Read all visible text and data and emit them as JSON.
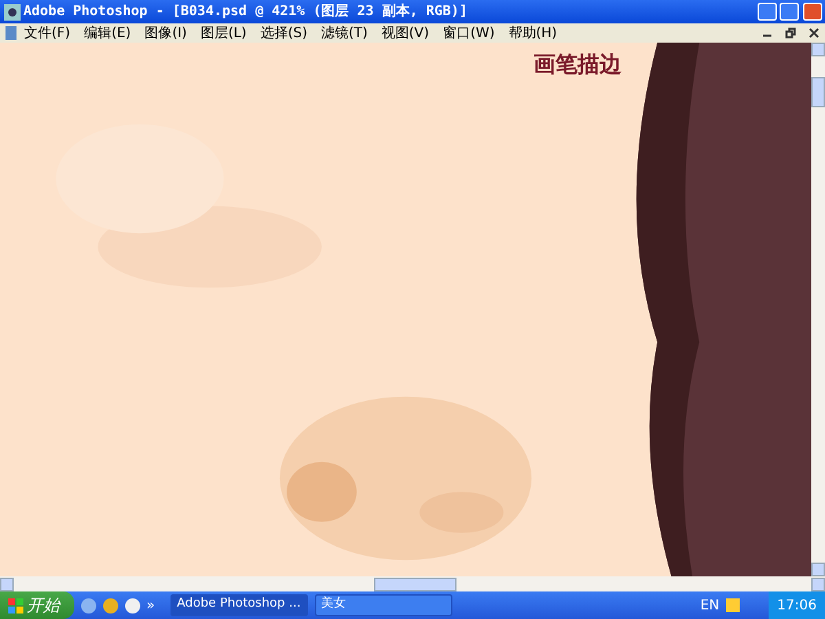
{
  "window": {
    "title": "Adobe Photoshop - [B034.psd @ 421% (图层 23 副本, RGB)]"
  },
  "menu": [
    "文件(F)",
    "编辑(E)",
    "图像(I)",
    "图层(L)",
    "选择(S)",
    "滤镜(T)",
    "视图(V)",
    "窗口(W)",
    "帮助(H)"
  ],
  "canvas": {
    "kind": "picture",
    "caption": "画笔描边"
  },
  "taskbar": {
    "start": "开始",
    "more": "»",
    "tasks": [
      {
        "label": "Adobe Photoshop ...",
        "selected": true
      },
      {
        "label": "美女",
        "selected": false
      }
    ],
    "language": "EN",
    "clock": "17:06"
  }
}
